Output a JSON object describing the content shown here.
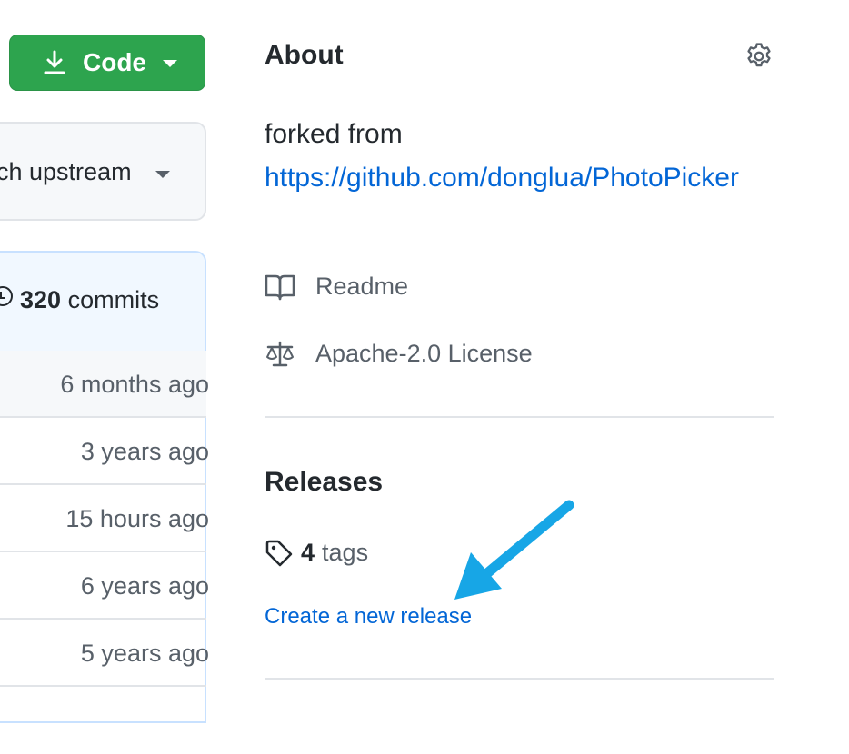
{
  "code_button": {
    "label": "Code",
    "icon": "download-icon"
  },
  "fetch": {
    "label": "Fetch upstream"
  },
  "commits": {
    "count": "320",
    "label": "commits"
  },
  "file_rows": [
    {
      "time": "6 months ago"
    },
    {
      "time": "3 years ago"
    },
    {
      "time": "15 hours ago"
    },
    {
      "time": "6 years ago"
    },
    {
      "time": "5 years ago"
    }
  ],
  "about": {
    "title": "About",
    "forked_prefix": "forked from",
    "forked_link": "https://github.com/donglua/PhotoPicker",
    "readme": "Readme",
    "license": "Apache-2.0 License"
  },
  "releases": {
    "title": "Releases",
    "tag_count": "4",
    "tags_label": "tags",
    "create_link": "Create a new release"
  },
  "colors": {
    "accent_green": "#2da44e",
    "link_blue": "#0366d6",
    "annotation_arrow": "#17a6e6"
  }
}
